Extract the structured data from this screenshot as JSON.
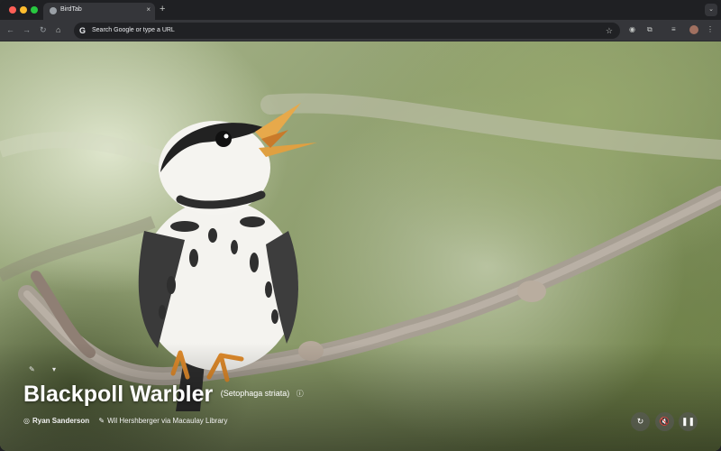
{
  "browser": {
    "tab": {
      "title": "BirdTab",
      "favicon": "birdtab-icon",
      "close": "×"
    },
    "new_tab": "+",
    "tab_search": "⌄",
    "nav": {
      "back": "←",
      "forward": "→",
      "reload": "↻",
      "home": "⌂"
    },
    "omnibox": {
      "g_icon": "G",
      "placeholder": "Search Google or type a URL",
      "star": "☆"
    },
    "toolbar_icons": {
      "extension_1": "◉",
      "extensions": "⧉",
      "reading_list": "≡",
      "menu": "⋮"
    }
  },
  "bird": {
    "common_name": "Blackpoll Warbler",
    "scientific_name": "(Setophaga striata)",
    "info_icon": "ⓘ",
    "photographer": "Ryan Sanderson",
    "recordist": "Wil Hershberger",
    "source": "via Macaulay Library",
    "camera_icon": "◎",
    "mic_icon": "✎"
  },
  "small_icons": {
    "icon_1": "✎",
    "icon_2": "▾"
  },
  "controls": {
    "refresh": "↻",
    "mute": "🔇",
    "pause": "❚❚"
  }
}
